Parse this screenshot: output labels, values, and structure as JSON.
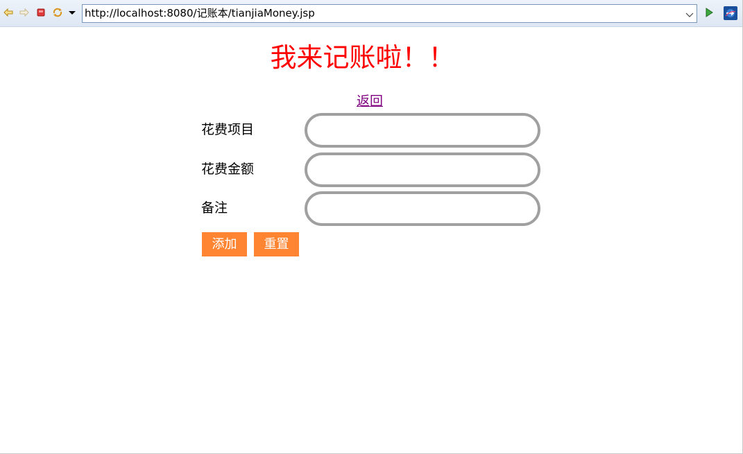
{
  "browser": {
    "url": "http://localhost:8080/记账本/tianjiaMoney.jsp",
    "icons": [
      "back-arrow-icon",
      "forward-arrow-icon",
      "stop-icon",
      "refresh-icon",
      "menu-dropdown-icon",
      "url-dropdown-icon",
      "go-icon",
      "external-browser-icon"
    ]
  },
  "page": {
    "title": "我来记账啦！！",
    "back_link": "返回"
  },
  "form": {
    "fields": [
      {
        "label": "花费项目",
        "value": ""
      },
      {
        "label": "花费金额",
        "value": ""
      },
      {
        "label": "备注",
        "value": ""
      }
    ],
    "submit_label": "添加",
    "reset_label": "重置"
  },
  "colors": {
    "title": "#ff0000",
    "link_visited": "#800080",
    "button_bg": "#ff8533",
    "button_text": "#ffffff",
    "input_border": "#a0a0a0"
  }
}
